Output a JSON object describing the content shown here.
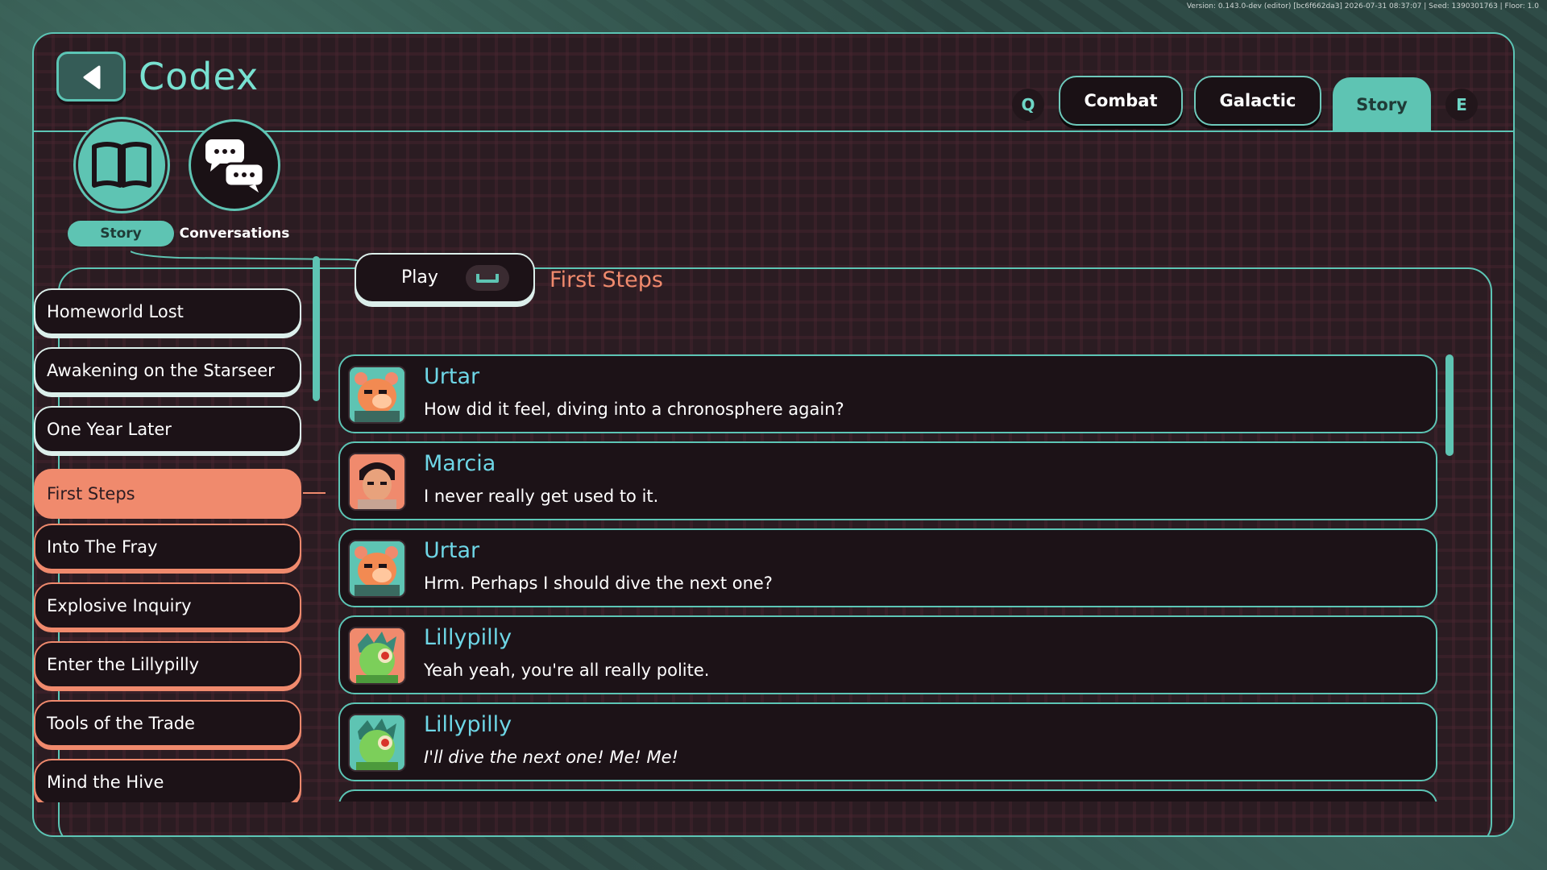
{
  "version_text": "Version: 0.143.0-dev (editor) [bc6f662da3] 2026-07-31 08:37:07 | Seed: 1390301763 | Floor: 1.0",
  "header": {
    "title": "Codex",
    "tabs": [
      {
        "label": "Combat",
        "active": false
      },
      {
        "label": "Galactic",
        "active": false
      },
      {
        "label": "Story",
        "active": true
      }
    ],
    "prev_key": "Q",
    "next_key": "E"
  },
  "categories": [
    {
      "label": "Story",
      "icon": "open-book-icon",
      "active": true
    },
    {
      "label": "Conversations",
      "icon": "speech-bubbles-icon",
      "active": false
    }
  ],
  "conversations_list": [
    {
      "label": "Homeworld Lost",
      "state": "read"
    },
    {
      "label": "Awakening on the Starseer",
      "state": "read"
    },
    {
      "label": "One Year Later",
      "state": "read"
    },
    {
      "label": "First Steps",
      "state": "selected"
    },
    {
      "label": "Into The Fray",
      "state": "unread"
    },
    {
      "label": "Explosive Inquiry",
      "state": "unread"
    },
    {
      "label": "Enter the Lillypilly",
      "state": "unread"
    },
    {
      "label": "Tools of the Trade",
      "state": "unread"
    },
    {
      "label": "Mind the Hive",
      "state": "unread"
    }
  ],
  "detail": {
    "play_label": "Play",
    "play_key_icon": "spacebar-icon",
    "title": "First Steps",
    "lines": [
      {
        "speaker": "Urtar",
        "portrait": "urtar",
        "text": "How did it feel, diving into a chronosphere again?",
        "emphasis": ""
      },
      {
        "speaker": "Marcia",
        "portrait": "marcia",
        "text": "I never really get used to it.",
        "emphasis": ""
      },
      {
        "speaker": "Urtar",
        "portrait": "urtar",
        "text": "Hrm. Perhaps I should dive the next one?",
        "emphasis": ""
      },
      {
        "speaker": "Lillypilly",
        "portrait": "lillypilly",
        "text": "Yeah yeah, you're all really polite.",
        "emphasis": ""
      },
      {
        "speaker": "Lillypilly",
        "portrait": "lillypilly",
        "text": "I'll dive the next one! ",
        "emphasis": "Me! Me!"
      }
    ]
  },
  "colors": {
    "teal": "#5ec4b3",
    "coral": "#f08a6d",
    "panel_bg": "#2b1c22",
    "speaker_name": "#6ed6e6"
  }
}
